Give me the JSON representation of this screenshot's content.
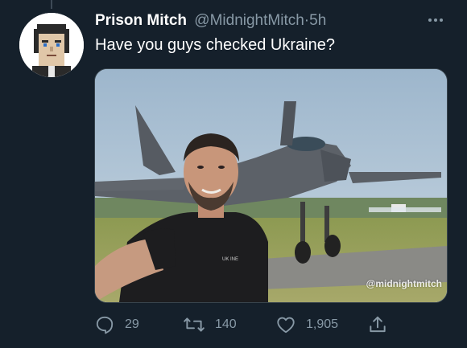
{
  "tweet": {
    "author_name": "Prison Mitch",
    "author_handle": "@MidnightMitch",
    "separator": "·",
    "time": "5h",
    "text": "Have you guys checked Ukraine?",
    "media": {
      "watermark": "@midnightmitch",
      "shirt_text": "UK INE"
    }
  },
  "actions": {
    "replies": "29",
    "retweets": "140",
    "likes": "1,905"
  },
  "icons": {
    "more": "more-icon",
    "reply": "reply-icon",
    "retweet": "retweet-icon",
    "like": "heart-icon",
    "share": "share-icon"
  },
  "colors": {
    "background": "#15202b",
    "secondary_text": "#8899a6",
    "primary_text": "#ffffff"
  }
}
